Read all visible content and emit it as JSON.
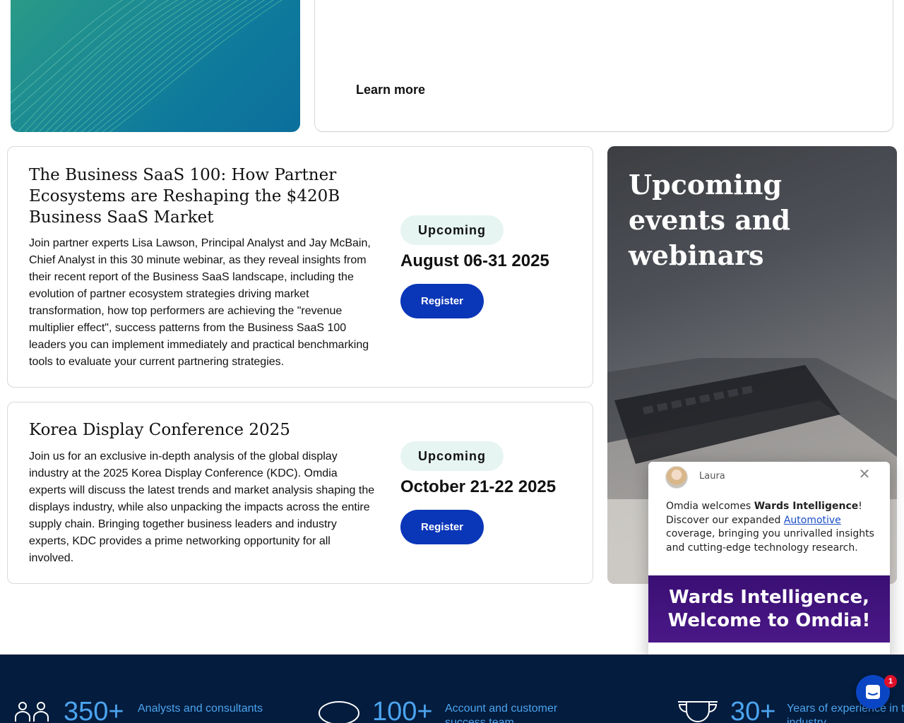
{
  "promo": {
    "learn_more": "Learn more"
  },
  "events": [
    {
      "title": "The Business SaaS 100: How Partner Ecosystems are Reshaping the $420B Business SaaS Market",
      "description": "Join partner experts Lisa Lawson, Principal Analyst and Jay McBain, Chief Analyst in this 30 minute webinar, as they reveal insights from their recent report of the Business SaaS landscape, including the evolution of partner ecosystem strategies driving market transformation, how top performers are achieving the \"revenue multiplier effect\", success patterns from the Business SaaS 100 leaders you can implement immediately and practical benchmarking tools to evaluate your current partnering strategies.",
      "status": "Upcoming",
      "date": "August 06-31 2025",
      "register_label": "Register"
    },
    {
      "title": "Korea Display Conference 2025",
      "description": "Join us for an exclusive in-depth analysis of the global display industry at the 2025 Korea Display Conference (KDC). Omdia experts will discuss the latest trends and market analysis shaping the displays industry, while also unpacking the impacts across the entire supply chain. Bringing together business leaders and industry experts, KDC provides a prime networking opportunity for all involved.",
      "status": "Upcoming",
      "date": "October 21-22 2025",
      "register_label": "Register"
    }
  ],
  "side_panel": {
    "title": "Upcoming events and webinars"
  },
  "chat": {
    "agent_name": "Laura",
    "close_icon": "close-icon",
    "message_prefix": "Omdia welcomes ",
    "message_bold": "Wards Intelligence",
    "message_mid": "! Discover our expanded ",
    "message_link": "Automotive",
    "message_suffix": " coverage, bringing you unrivalled insights and cutting-edge technology research.",
    "banner_line1": "Wards Intelligence,",
    "banner_line2": "Welcome to Omdia!"
  },
  "stats": [
    {
      "number": "350+",
      "label": "Analysts and consultants",
      "icon": "people-icon"
    },
    {
      "number": "100+",
      "label": "Account and customer success team",
      "icon": "chat-bubble-icon"
    },
    {
      "number": "30+",
      "label": "Years of experience in the industry",
      "icon": "trophy-icon"
    }
  ],
  "messenger": {
    "unread_count": "1"
  },
  "colors": {
    "register_button": "#0a36b8",
    "badge_bg": "#e6f5f1",
    "stats_bg": "#041c3d",
    "stats_text": "#4ba4ef",
    "banner_purple": "#3a0f73"
  }
}
